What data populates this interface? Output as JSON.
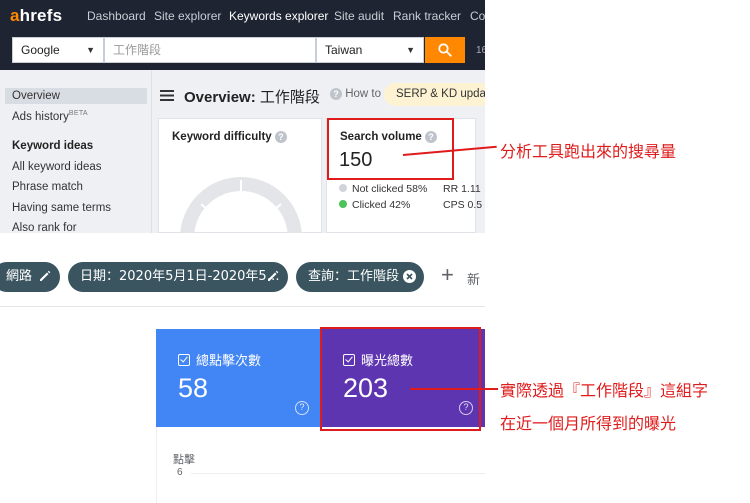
{
  "ahrefs": {
    "logo": {
      "first": "a",
      "rest": "hrefs"
    },
    "nav": [
      "Dashboard",
      "Site explorer",
      "Keywords explorer",
      "Site audit",
      "Rank tracker",
      "Co"
    ],
    "nav_active": "Keywords explorer",
    "search": {
      "engine": "Google",
      "keyword_placeholder": "工作階段",
      "country": "Taiwan",
      "corner_text": "16"
    },
    "sidebar": {
      "overview": "Overview",
      "ads_history": "Ads history",
      "ads_history_badge": "BETA",
      "keyword_ideas_heading": "Keyword ideas",
      "items": [
        "All keyword ideas",
        "Phrase match",
        "Having same terms",
        "Also rank for"
      ]
    },
    "header": {
      "title_bold": "Overview:",
      "title_keyword": "工作階段",
      "howto": "How to",
      "badge": "SERP & KD update"
    },
    "kd_card": {
      "title": "Keyword difficulty"
    },
    "sv_card": {
      "title": "Search volume",
      "value": "150",
      "not_clicked": "Not clicked 58%",
      "clicked": "Clicked 42%",
      "rr": "RR 1.11",
      "cps": "CPS 0.5"
    },
    "annotation": "分析工具跑出來的搜尋量"
  },
  "gsc": {
    "chips": {
      "search_type": "網路",
      "date": "日期：2020年5月1日-2020年5…",
      "query": "查詢：工作階段"
    },
    "add_label": "新",
    "clicks": {
      "label": "總點擊次數",
      "value": "58"
    },
    "impressions": {
      "label": "曝光總數",
      "value": "203"
    },
    "chart": {
      "ylabel": "點擊",
      "tick": "6"
    },
    "annotation_line1": "實際透過『工作階段』這組字",
    "annotation_line2": "在近一個月所得到的曝光"
  },
  "colors": {
    "ahrefs_nav": "#1e2431",
    "ahrefs_orange": "#ff8800",
    "annotation_red": "#e01b1b",
    "gsc_clicks_blue": "#4285f4",
    "gsc_impressions_purple": "#5e35b1",
    "gsc_chip": "#3b5560",
    "clicked_green": "#4cc45a"
  },
  "icons": [
    "search-icon",
    "hamburger-icon",
    "help-icon",
    "pencil-icon",
    "close-circle-icon",
    "plus-icon",
    "checkbox-icon",
    "caret-down-icon"
  ]
}
